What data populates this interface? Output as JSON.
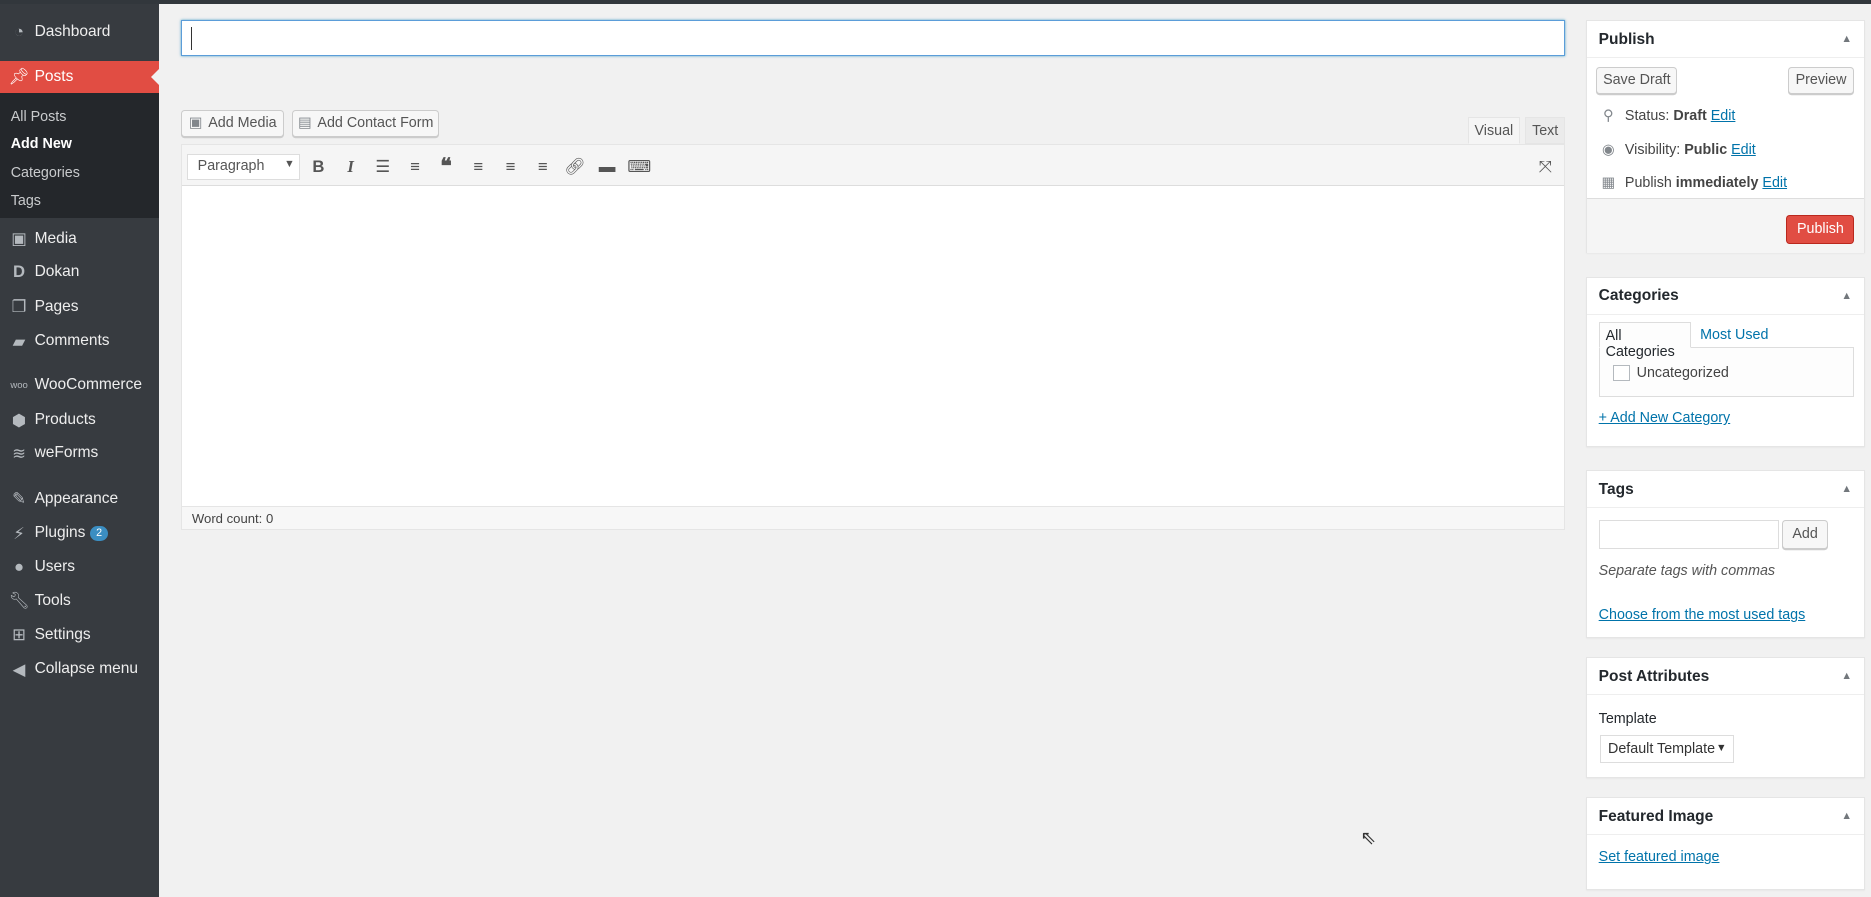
{
  "sidebar": {
    "items": [
      {
        "label": "Dashboard",
        "icon": "dashboard-icon"
      },
      {
        "label": "Posts",
        "icon": "pin-icon"
      },
      {
        "label": "Media",
        "icon": "media-icon"
      },
      {
        "label": "Dokan",
        "icon": "dokan-icon"
      },
      {
        "label": "Pages",
        "icon": "pages-icon"
      },
      {
        "label": "Comments",
        "icon": "comment-icon"
      },
      {
        "label": "WooCommerce",
        "icon": "woo-icon"
      },
      {
        "label": "Products",
        "icon": "box-icon"
      },
      {
        "label": "weForms",
        "icon": "weforms-icon"
      },
      {
        "label": "Appearance",
        "icon": "brush-icon"
      },
      {
        "label": "Plugins",
        "icon": "plug-icon",
        "badge": "2"
      },
      {
        "label": "Users",
        "icon": "user-icon"
      },
      {
        "label": "Tools",
        "icon": "wrench-icon"
      },
      {
        "label": "Settings",
        "icon": "settings-icon"
      },
      {
        "label": "Collapse menu",
        "icon": "collapse-icon"
      }
    ],
    "submenu": [
      "All Posts",
      "Add New",
      "Categories",
      "Tags"
    ],
    "active_color": "#e14d43"
  },
  "editor": {
    "title_value": "",
    "add_media": "Add Media",
    "add_contact_form": "Add Contact Form",
    "tab_visual": "Visual",
    "tab_text": "Text",
    "format_select": "Paragraph",
    "word_count": "Word count: 0"
  },
  "publish": {
    "title": "Publish",
    "save_draft": "Save Draft",
    "preview": "Preview",
    "status_label": "Status:",
    "status_value": "Draft",
    "visibility_label": "Visibility:",
    "visibility_value": "Public",
    "publish_label": "Publish",
    "publish_value": "immediately",
    "edit": "Edit",
    "publish_button": "Publish"
  },
  "categories": {
    "title": "Categories",
    "tab_all": "All Categories",
    "tab_most": "Most Used",
    "items": [
      "Uncategorized"
    ],
    "add_new": "+ Add New Category"
  },
  "tags": {
    "title": "Tags",
    "add": "Add",
    "hint": "Separate tags with commas",
    "choose": "Choose from the most used tags"
  },
  "post_attributes": {
    "title": "Post Attributes",
    "template_label": "Template",
    "template_value": "Default Template"
  },
  "featured_image": {
    "title": "Featured Image",
    "set": "Set featured image"
  }
}
